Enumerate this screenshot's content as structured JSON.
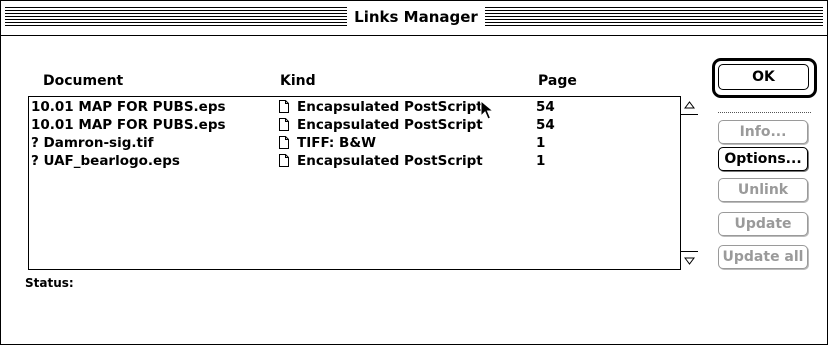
{
  "window": {
    "title": "Links Manager"
  },
  "columns": {
    "document": "Document",
    "kind": "Kind",
    "page": "Page"
  },
  "rows": [
    {
      "document": " 10.01 MAP FOR PUBS.eps",
      "kind": "Encapsulated PostScript",
      "page": "54",
      "icon": "document-icon"
    },
    {
      "document": " 10.01 MAP FOR PUBS.eps",
      "kind": "Encapsulated PostScript",
      "page": "54",
      "icon": "document-icon"
    },
    {
      "document": "? Damron-sig.tif",
      "kind": "TIFF: B&W",
      "page": "1",
      "icon": "document-icon"
    },
    {
      "document": "? UAF_bearlogo.eps",
      "kind": "Encapsulated PostScript",
      "page": "1",
      "icon": "document-icon"
    }
  ],
  "buttons": {
    "ok": "OK",
    "info": "Info...",
    "options": "Options...",
    "unlink": "Unlink",
    "update": "Update",
    "update_all": "Update all"
  },
  "status": {
    "label": "Status:"
  }
}
